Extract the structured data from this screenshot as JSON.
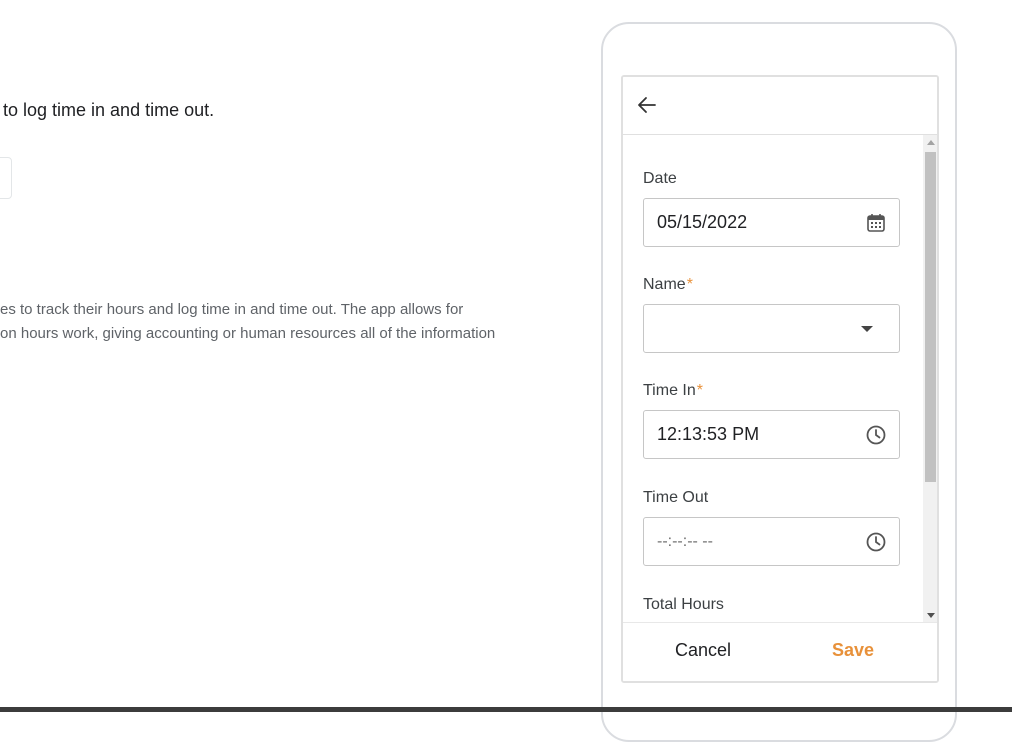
{
  "page": {
    "headline": "to log time in and time out.",
    "description_lines": [
      "es to track their hours and log time in and time out. The app allows for",
      "on hours work, giving accounting or human resources all of the information"
    ]
  },
  "app": {
    "back_icon": "arrow-left-icon",
    "fields": {
      "date": {
        "label": "Date",
        "value": "05/15/2022",
        "icon": "calendar-icon"
      },
      "name": {
        "label": "Name",
        "required_mark": "*",
        "value": ""
      },
      "time_in": {
        "label": "Time In",
        "required_mark": "*",
        "value": "12:13:53 PM",
        "icon": "clock-icon"
      },
      "time_out": {
        "label": "Time Out",
        "placeholder": "--:--:-- --",
        "icon": "clock-icon"
      },
      "total_hours": {
        "label": "Total Hours"
      }
    },
    "footer": {
      "cancel_label": "Cancel",
      "save_label": "Save"
    }
  },
  "colors": {
    "accent": "#e8913a",
    "border": "#c6c6c6"
  }
}
